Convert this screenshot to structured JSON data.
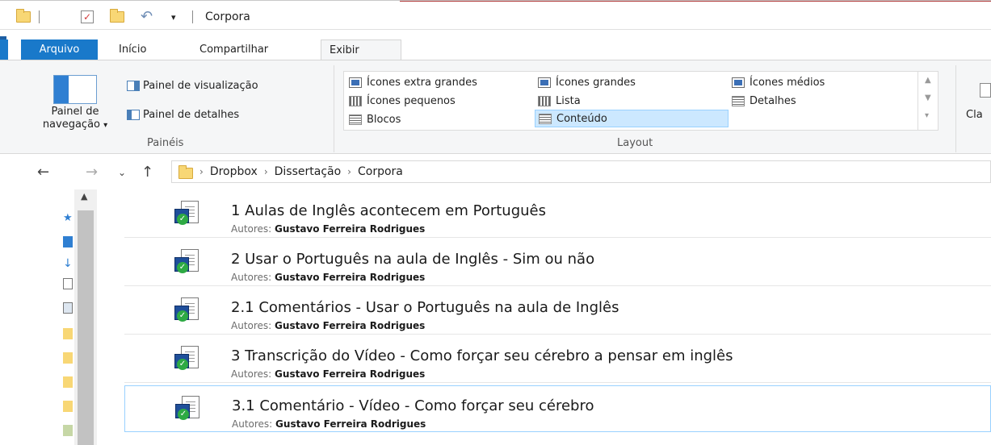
{
  "window": {
    "title": "Corpora"
  },
  "tabs": [
    {
      "label": "Arquivo"
    },
    {
      "label": "Início"
    },
    {
      "label": "Compartilhar"
    },
    {
      "label": "Exibir"
    }
  ],
  "ribbon": {
    "panes_group": {
      "navigation_pane_label": "Painel de navegação",
      "preview_pane_label": "Painel de visualização",
      "details_pane_label": "Painel de detalhes",
      "group_label": "Painéis"
    },
    "layout_group": {
      "group_label": "Layout",
      "items": [
        {
          "label": "Ícones extra grandes"
        },
        {
          "label": "Ícones grandes"
        },
        {
          "label": "Ícones médios"
        },
        {
          "label": "Ícones pequenos"
        },
        {
          "label": "Lista"
        },
        {
          "label": "Detalhes"
        },
        {
          "label": "Blocos"
        },
        {
          "label": "Conteúdo",
          "selected": true
        }
      ]
    },
    "next_group_partial_label": "Cla"
  },
  "address": {
    "path": [
      "Dropbox",
      "Dissertação",
      "Corpora"
    ]
  },
  "files": [
    {
      "title": "1 Aulas de Inglês acontecem em Português",
      "meta_key": "Autores:",
      "meta_value": "Gustavo Ferreira Rodrigues"
    },
    {
      "title": "2 Usar o Português na aula de Inglês - Sim ou não",
      "meta_key": "Autores:",
      "meta_value": "Gustavo Ferreira Rodrigues"
    },
    {
      "title": "2.1 Comentários - Usar o Português na aula de Inglês",
      "meta_key": "Autores:",
      "meta_value": "Gustavo Ferreira Rodrigues"
    },
    {
      "title": "3 Transcrição do Vídeo - Como forçar seu cérebro a pensar em inglês",
      "meta_key": "Autores:",
      "meta_value": "Gustavo Ferreira Rodrigues"
    },
    {
      "title": "3.1 Comentário - Vídeo - Como forçar seu cérebro",
      "meta_key": "Autores:",
      "meta_value": "Gustavo Ferreira Rodrigues",
      "selected": true
    }
  ],
  "colors": {
    "file_tab": "#1979ca",
    "selection_fill": "#cce8ff",
    "selection_border": "#99d1ff",
    "folder": "#f8d775"
  }
}
